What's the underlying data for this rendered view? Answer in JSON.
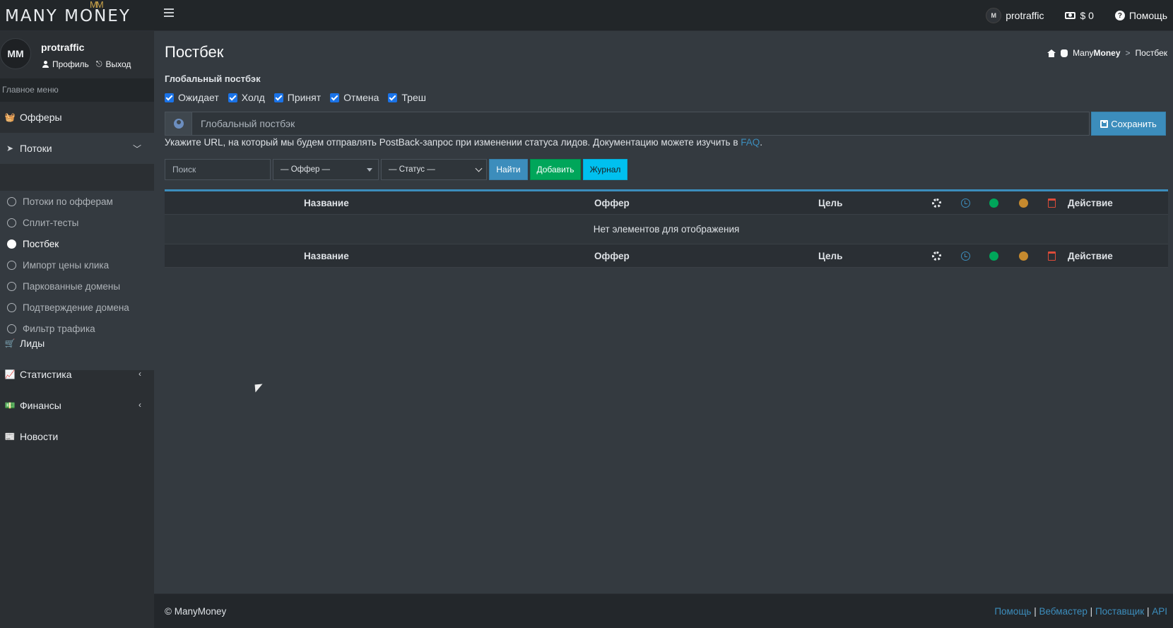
{
  "brand": {
    "name": "MANY MONEY",
    "crown": "ΜΜ"
  },
  "topbar": {
    "username": "protraffic",
    "avatar": "M",
    "balance": "$ 0",
    "help": "Помощь"
  },
  "sidebar": {
    "avatar": "MM",
    "username": "protraffic",
    "profile": "Профиль",
    "logout": "Выход",
    "section": "Главное меню",
    "items": [
      {
        "label": "Офферы",
        "icon": "basket-icon"
      },
      {
        "label": "Потоки",
        "icon": "paper-plane-icon"
      },
      {
        "label": "Лиды",
        "icon": "cart-icon"
      },
      {
        "label": "Статистика",
        "icon": "chart-icon"
      },
      {
        "label": "Финансы",
        "icon": "cash-icon"
      },
      {
        "label": "Новости",
        "icon": "newspaper-icon"
      }
    ],
    "subitems": [
      "Потоки по офферам",
      "Сплит-тесты",
      "Постбек",
      "Импорт цены клика",
      "Паркованные домены",
      "Подтверждение домена",
      "Фильтр трафика"
    ]
  },
  "page": {
    "title": "Постбек",
    "breadcrumb": {
      "brand_a": "Many",
      "brand_b": "Money",
      "sep": ">",
      "current": "Постбек"
    }
  },
  "global_postback": {
    "title": "Глобальный постбэк",
    "statuses": [
      "Ожидает",
      "Холд",
      "Принят",
      "Отмена",
      "Треш"
    ],
    "placeholder": "Глобальный постбэк",
    "save": "Сохранить",
    "help": "Укажите URL, на который мы будем отправлять PostBack-запрос при изменении статуса лидов. Документацию можете изучить в",
    "help_link": "FAQ",
    "help_end": "."
  },
  "filters": {
    "search_placeholder": "Поиск",
    "offer": "— Оффер —",
    "status": "— Статус —",
    "find": "Найти",
    "add": "Добавить",
    "log": "Журнал"
  },
  "table": {
    "columns": {
      "name": "Название",
      "offer": "Оффер",
      "goal": "Цель",
      "action": "Действие"
    },
    "empty": "Нет элементов для отображения"
  },
  "footer": {
    "copyright": "© ManyMoney",
    "links": [
      "Помощь",
      "Вебмастер",
      "Поставщик",
      "API"
    ],
    "sep": "|"
  },
  "colors": {
    "accent": "#3c8dbc",
    "success": "#00a65a",
    "info": "#00c0ef",
    "danger": "#dd4b39",
    "warning": "#c68a2e"
  }
}
